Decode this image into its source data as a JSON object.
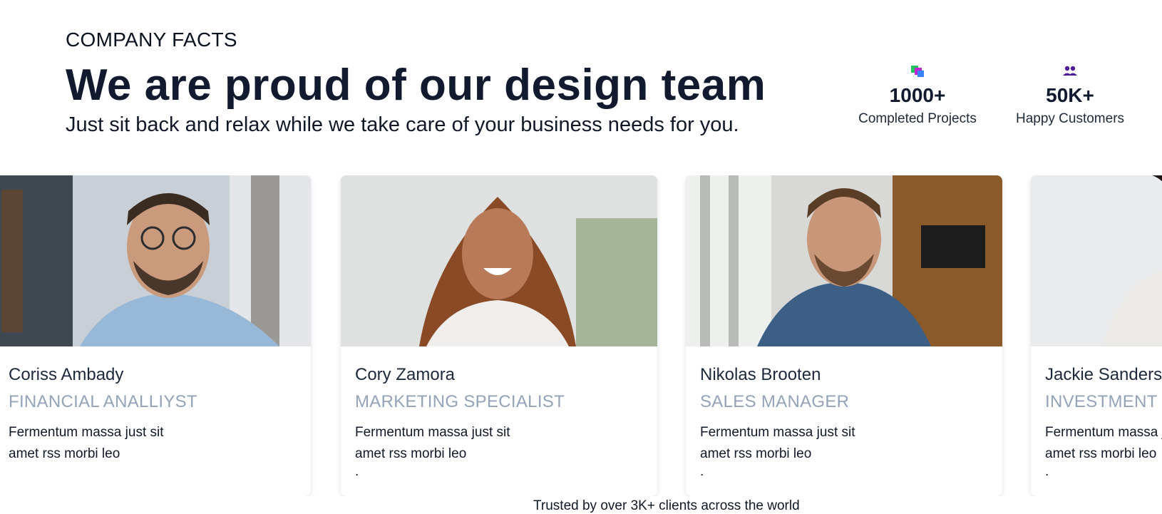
{
  "header": {
    "eyebrow": "COMPANY FACTS",
    "headline": "We are proud of our design team",
    "subline": "Just sit back and relax while we take care of your business needs for you."
  },
  "stats": [
    {
      "icon": "projects-icon",
      "value": "1000+",
      "label": "Completed Projects"
    },
    {
      "icon": "customers-icon",
      "value": "50K+",
      "label": "Happy Customers"
    }
  ],
  "team": [
    {
      "name": "Coriss Ambady",
      "role": "FINANCIAL ANALLIYST",
      "desc": "Fermentum massa just sit amet rss morbi leo",
      "dot": ""
    },
    {
      "name": "Cory Zamora",
      "role": "MARKETING SPECIALIST",
      "desc": "Fermentum massa just sit amet rss morbi leo",
      "dot": "."
    },
    {
      "name": "Nikolas Brooten",
      "role": "SALES MANAGER",
      "desc": "Fermentum massa just sit amet rss morbi leo",
      "dot": "."
    },
    {
      "name": "Jackie Sanders",
      "role": "INVESTMENT PLANNER",
      "desc": "Fermentum massa just sit amet rss morbi leo",
      "dot": "."
    }
  ],
  "footer": {
    "trusted": "Trusted by over 3K+ clients across the world"
  },
  "colors": {
    "heading": "#111a2e",
    "role": "#94a3b8",
    "accent_green": "#22c55e",
    "accent_purple": "#4c1d95"
  }
}
